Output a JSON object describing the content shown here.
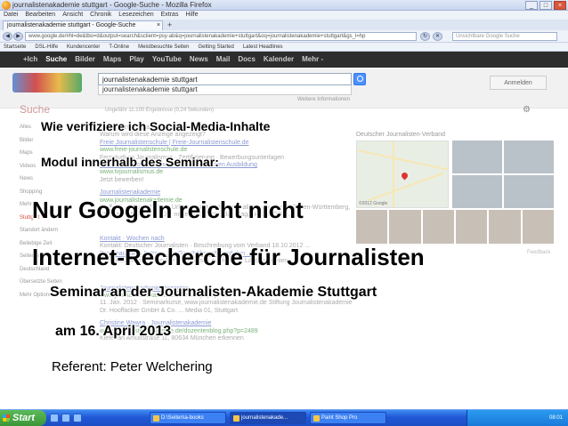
{
  "window": {
    "title": "journalistenakademie stuttgart - Google-Suche - Mozilla Firefox"
  },
  "menubar": [
    "Datei",
    "Bearbeiten",
    "Ansicht",
    "Chronik",
    "Lesezeichen",
    "Extras",
    "Hilfe"
  ],
  "tab": {
    "label": "journalistenakademie stuttgart - Google-Suche"
  },
  "navbar": {
    "url": "www.google.de/#hl=de&tbo=d&output=search&sclient=psy-ab&q=journalistenakademie+stuttgart&oq=journalistenakademie+stuttgart&gs_l=hp",
    "search_placeholder": "Unsichtbare Google Suche"
  },
  "bookmarks": [
    "Startseite",
    "DSL-Hilfe",
    "Kundencenter",
    "T-Online",
    "Meistbesuchte Seiten",
    "Getting Started",
    "Latest Headlines"
  ],
  "google": {
    "topbar": [
      "+Ich",
      "Suche",
      "Bilder",
      "Maps",
      "Play",
      "YouTube",
      "News",
      "Mail",
      "Docs",
      "Kalender",
      "Mehr -"
    ],
    "query": "journalistenakademie stuttgart",
    "suggestion": "journalistenakademie stuttgart",
    "weitere": "Weitere Informationen",
    "signin": "Anmelden",
    "suche_label": "Suche",
    "stats": "Ungefähr 11.100 Ergebnisse (0,24 Sekunden)",
    "leftnav": [
      "Alles",
      "Bilder",
      "Maps",
      "Videos",
      "News",
      "Shopping",
      "Mehr",
      "",
      "Stuttgart",
      "Standort ändern",
      "",
      "Beliebige Zeit",
      "Seiten aus Deutschland",
      "Übersetzte Seiten",
      "Mehr Optionen"
    ],
    "results": [
      {
        "title": "Anzeige zu journalistenakademie stuttgart",
        "url": "",
        "snippet": "Warum wird diese Anzeige angezeigt?"
      },
      {
        "title": "Freie Journalistenschule | Freie-Journalistenschule.de",
        "url": "www.freie-journalistenschule.de",
        "snippet": "Fernstudium Journalismus · Zertifizierung · Bewerbungsunterlagen"
      },
      {
        "title": "Studium TV-Journalismus - Träume brauchen Ausbildung",
        "url": "www.tvjournalismus.de",
        "snippet": "Jetzt bewerben!"
      },
      {
        "title": "Journalistenakademie",
        "url": "www.journalistenakademie.de",
        "snippet": "Treffer 1 - 10 von 140 - ... Urheberrecht in der Journalisten-Akademie Baden-Württemberg, Stuttgart (16.4.2012) · Der neue Blockpunkt, das Magazin des DJV ..."
      },
      {
        "title": "Kontakt · Wochen nach",
        "url": "",
        "snippet": "Kontakt: Deutscher Journalisten · Beschreibung vom Verband 18.10.2012 ..."
      },
      {
        "title": "Presseausweis Antrag · Zur Geschäftsstelle und den ...",
        "url": "",
        "snippet": "Presseausweis können Sie elektronisch ausfüllen ... Landesgremien ..."
      },
      {
        "title": "Journalistenakademie Dozenten",
        "url": "www.journalistenakademie.de/index.php?p=39",
        "snippet": "11. Jan. 2012 · Seminarkurse, www.journalistenakademie.de Stiftung Journalistenakademie Dr. Hooffacker GmbH & Co. ... Media 01, Stuttgart"
      },
      {
        "title": "Christine Wawra · Journalistenakademie",
        "url": "www.journalistenakademie.de/dozentenblog.php?p=2489",
        "snippet": "Kiefer an Amulfstraße 11, 80634 München erkennen"
      }
    ],
    "knowledge": {
      "title": "Deutscher Journalisten-Verband",
      "map_copyright": "©2012 Google"
    },
    "feedback": "Feedback"
  },
  "overlay": {
    "line1": "Wie verifiziere ich Social-Media-Inhalte",
    "line2": "Modul innerhalb des Seminar:",
    "line3": "Nur Googeln reicht nicht",
    "line4": "Internet-Recherche für Journalisten",
    "line5": "Seminar an der Journalisten-Akademie Stuttgart",
    "line6": "am 16. April 2013",
    "line7": "Referent: Peter Welchering"
  },
  "taskbar": {
    "start": "Start",
    "tasks": [
      "D:\\Seiten\\a-books",
      "journalistenakade...",
      "Paint Shop Pro"
    ],
    "clock": "08:01"
  }
}
